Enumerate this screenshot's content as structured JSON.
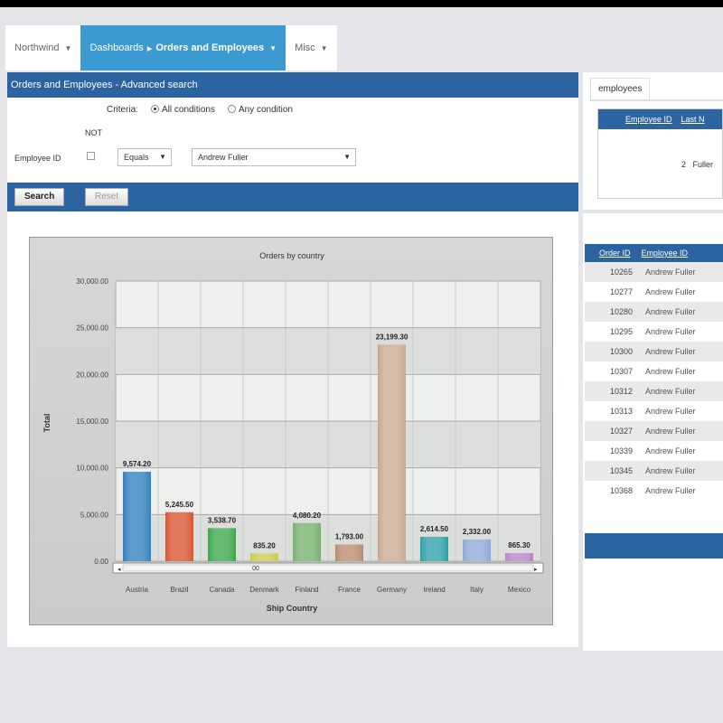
{
  "nav": {
    "home": "Northwind",
    "dash": "Dashboards",
    "current": "Orders and Employees",
    "misc": "Misc"
  },
  "search": {
    "title": "Orders and Employees - Advanced search",
    "criteria_label": "Criteria:",
    "opt_all": "All conditions",
    "opt_any": "Any condition",
    "not_label": "NOT",
    "field_label": "Employee ID",
    "operator": "Equals",
    "value": "Andrew Fuller",
    "search_btn": "Search",
    "reset_btn": "Reset"
  },
  "chart_data": {
    "type": "bar",
    "title": "Orders by country",
    "xlabel": "Ship Country",
    "ylabel": "Total",
    "ylim": [
      0,
      30000
    ],
    "yticks": [
      "0.00",
      "5,000.00",
      "10,000.00",
      "15,000.00",
      "20,000.00",
      "25,000.00",
      "30,000.00"
    ],
    "categories": [
      "Austria",
      "Brazil",
      "Canada",
      "Denmark",
      "Finland",
      "France",
      "Germany",
      "Ireland",
      "Italy",
      "Mexico"
    ],
    "values": [
      9574.2,
      5245.5,
      3538.7,
      835.2,
      4080.2,
      1793.0,
      23199.3,
      2614.5,
      2332.0,
      865.3
    ],
    "value_labels": [
      "9,574.20",
      "5,245.50",
      "3,538.70",
      "835.20",
      "4,080.20",
      "1,793.00",
      "23,199.30",
      "2,614.50",
      "2,332.00",
      "865.30"
    ],
    "colors": [
      "#2f7fbf",
      "#d9532d",
      "#3aa648",
      "#c9c94a",
      "#73b06b",
      "#b78a6b",
      "#c8a98f",
      "#2a9fa5",
      "#8ea7d8",
      "#b584c4"
    ],
    "scroll_label": "00",
    "grid": true
  },
  "right": {
    "tab": "employees",
    "emp_headers": [
      "Employee ID",
      "Last N"
    ],
    "emp_row": {
      "id": "2",
      "last": "Fuller"
    },
    "order_headers": [
      "Order ID",
      "Employee ID"
    ],
    "orders": [
      {
        "id": "10265",
        "emp": "Andrew Fuller"
      },
      {
        "id": "10277",
        "emp": "Andrew Fuller"
      },
      {
        "id": "10280",
        "emp": "Andrew Fuller"
      },
      {
        "id": "10295",
        "emp": "Andrew Fuller"
      },
      {
        "id": "10300",
        "emp": "Andrew Fuller"
      },
      {
        "id": "10307",
        "emp": "Andrew Fuller"
      },
      {
        "id": "10312",
        "emp": "Andrew Fuller"
      },
      {
        "id": "10313",
        "emp": "Andrew Fuller"
      },
      {
        "id": "10327",
        "emp": "Andrew Fuller"
      },
      {
        "id": "10339",
        "emp": "Andrew Fuller"
      },
      {
        "id": "10345",
        "emp": "Andrew Fuller"
      },
      {
        "id": "10368",
        "emp": "Andrew Fuller"
      }
    ]
  }
}
